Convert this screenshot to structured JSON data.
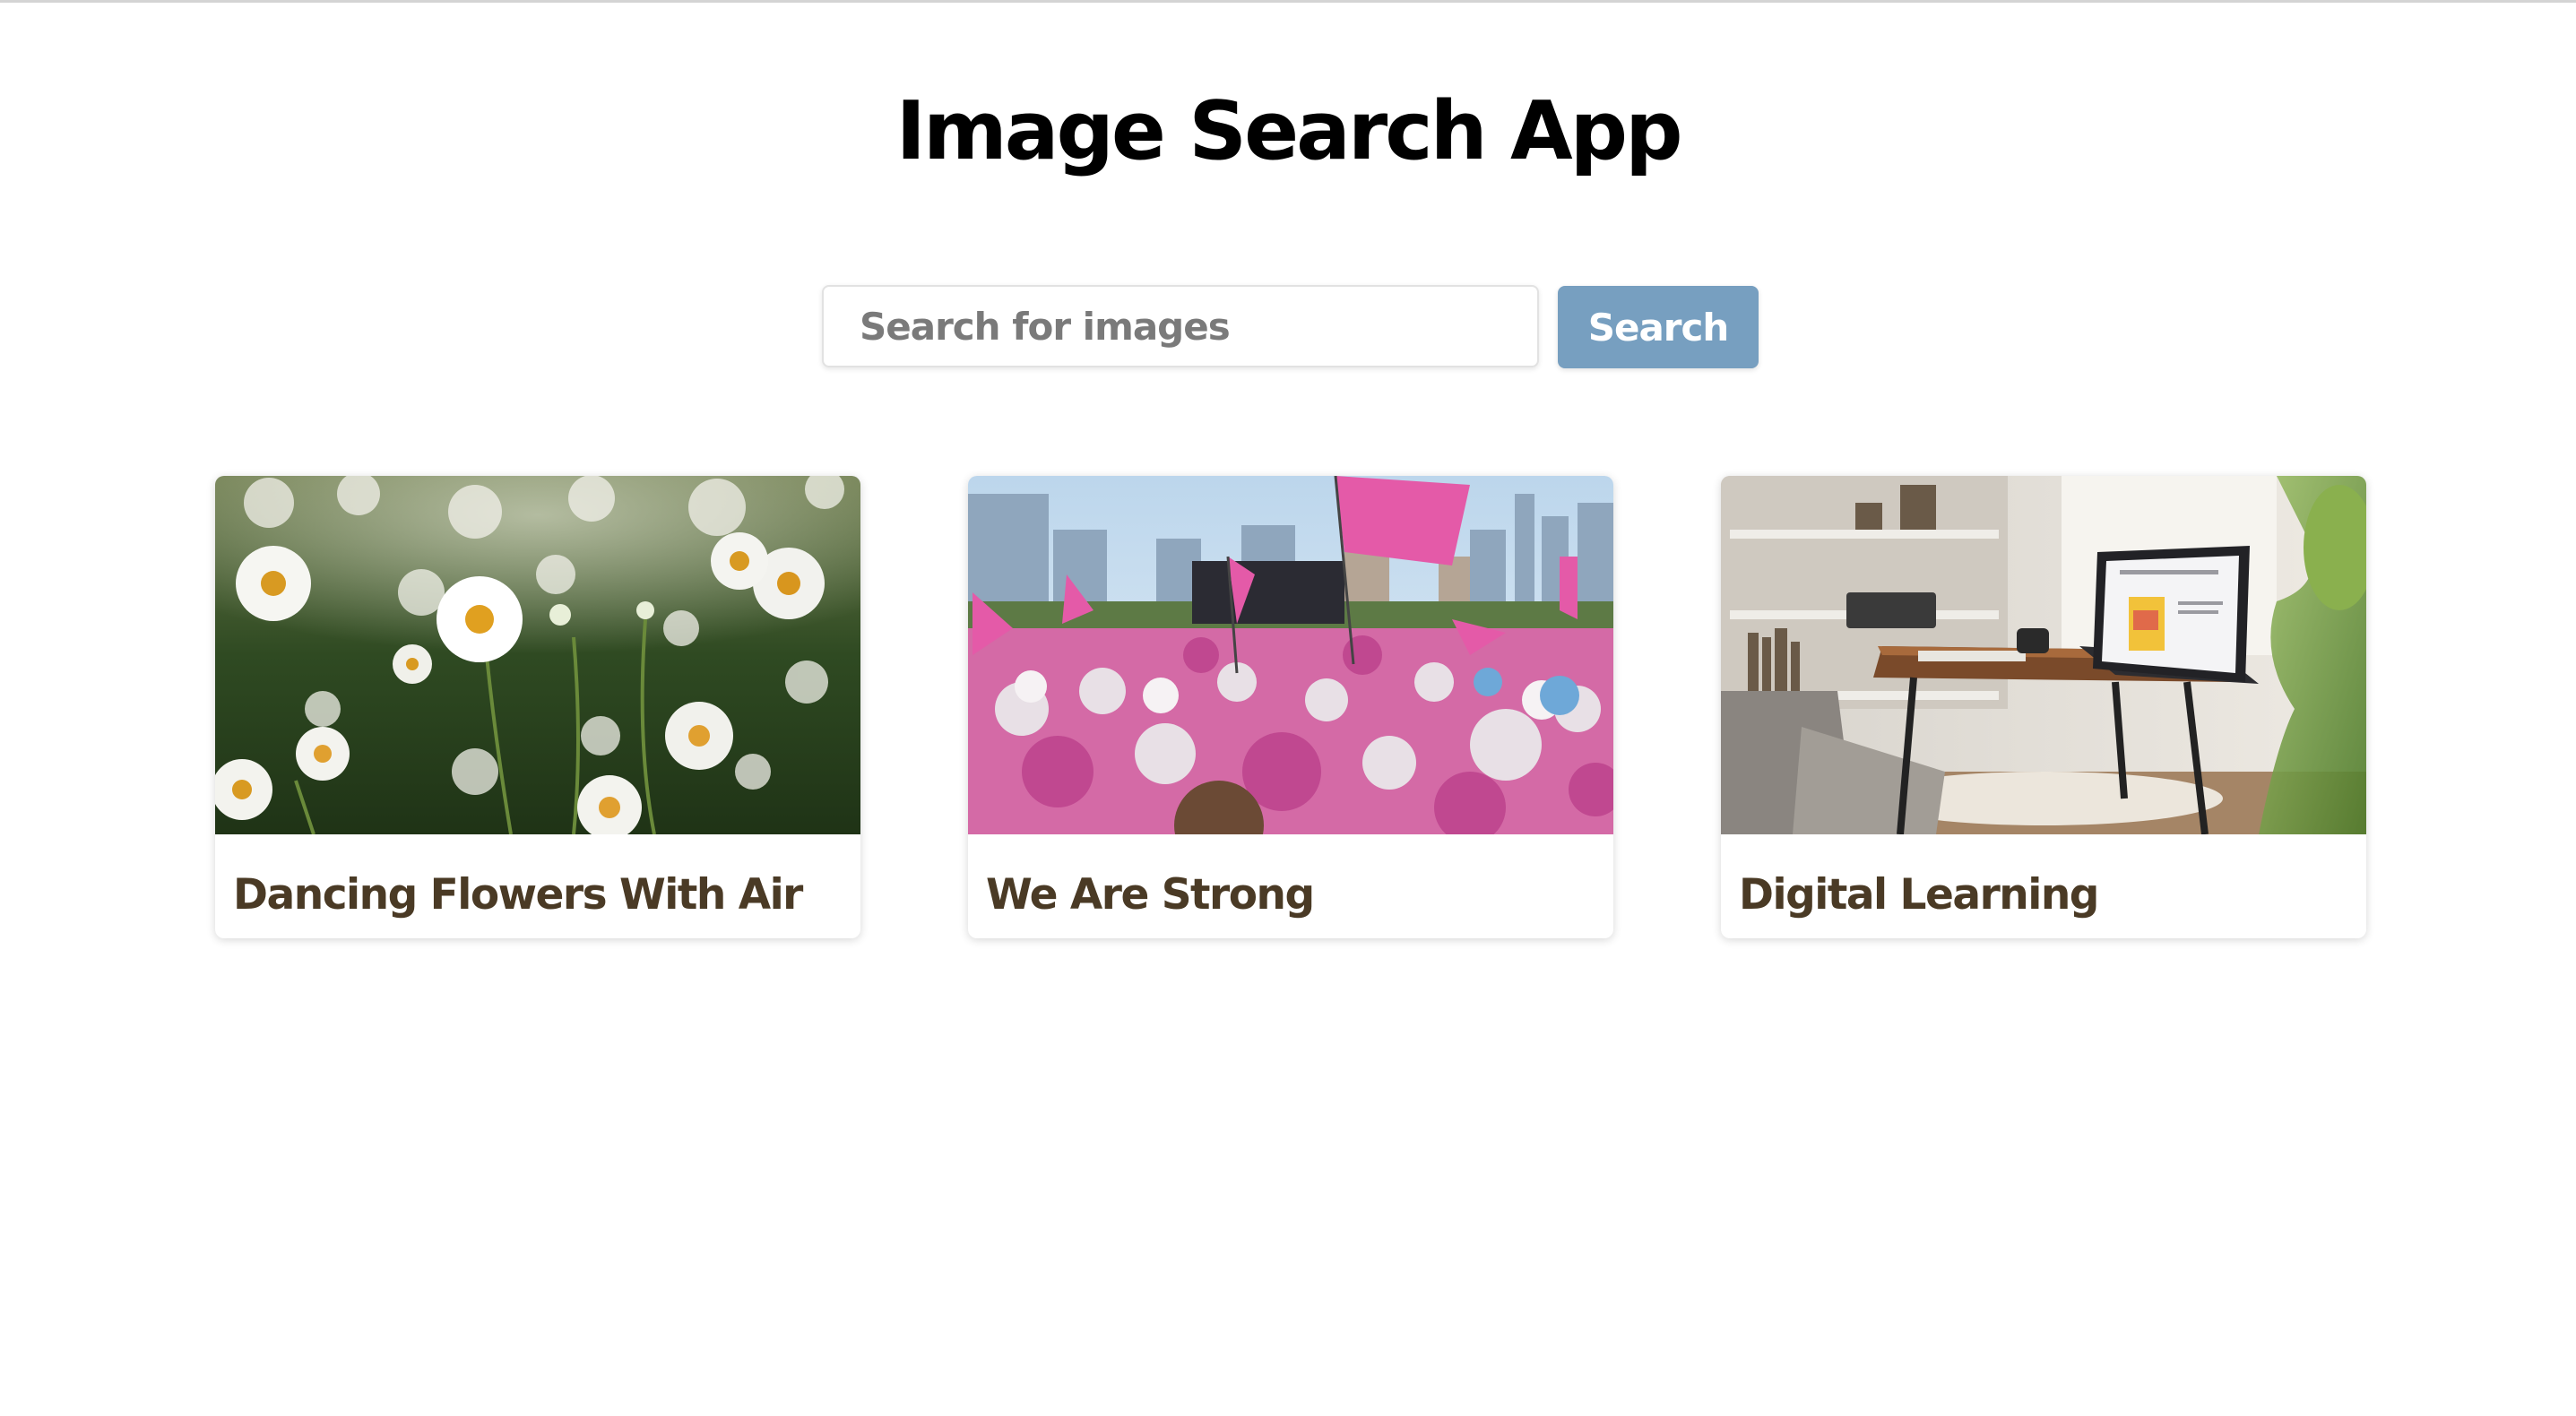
{
  "app": {
    "title": "Image Search App"
  },
  "search": {
    "placeholder": "Search for images",
    "value": "",
    "button_label": "Search",
    "button_color": "#779fc0"
  },
  "results": [
    {
      "title": "Dancing Flowers With Air",
      "image": "daisy-field-photo"
    },
    {
      "title": "We Are Strong",
      "image": "pink-rally-crowd-photo"
    },
    {
      "title": "Digital Learning",
      "image": "laptop-on-side-table-photo"
    }
  ],
  "colors": {
    "title_text": "#000000",
    "card_title_text": "#4a3a25",
    "page_background": "#ffffff"
  }
}
